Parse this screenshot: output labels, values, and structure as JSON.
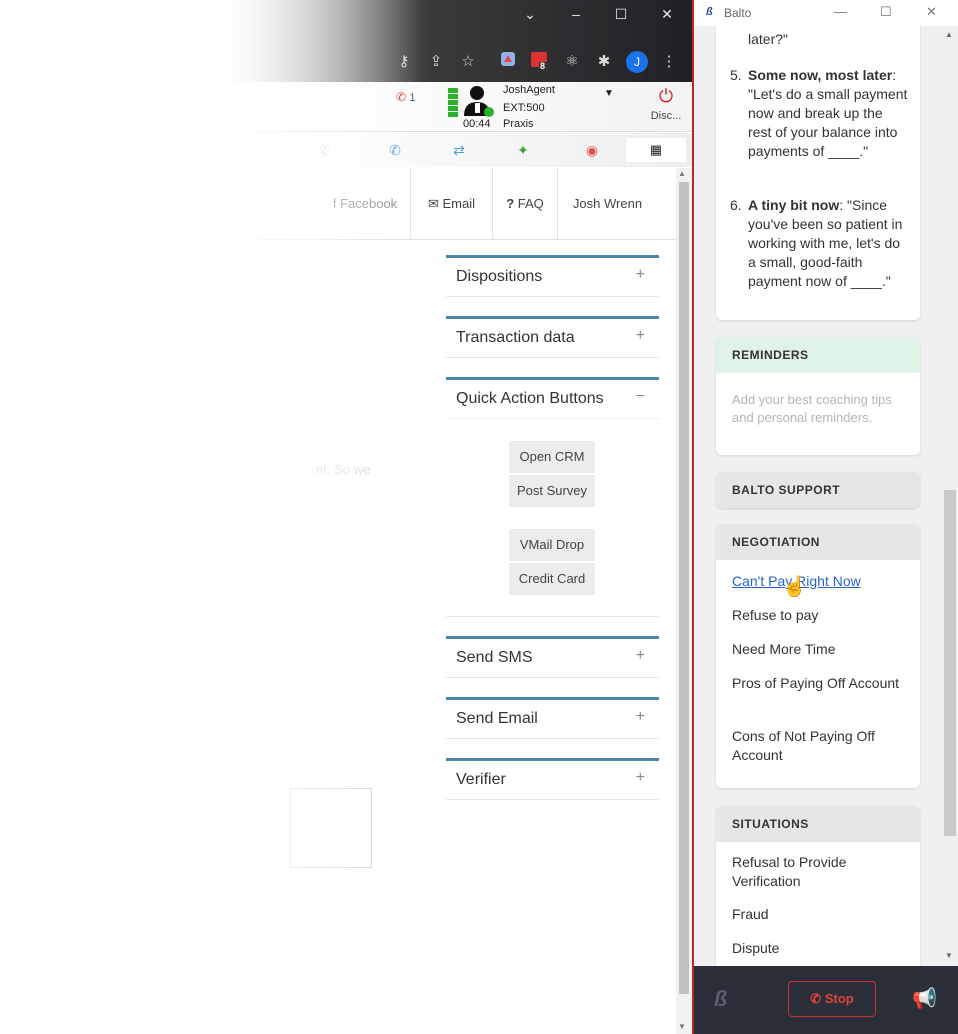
{
  "browser": {
    "window_controls": {
      "minimize": "–",
      "maximize": "☐",
      "close": "✕",
      "tab_menu": "⌄"
    },
    "profile_initial": "J",
    "extension_badge": "8"
  },
  "agent": {
    "missed_count": "1",
    "name": "JoshAgent",
    "ext": "EXT:500",
    "timer": "00:44",
    "campaign": "Praxis",
    "disconnect_label": "Disc..."
  },
  "nav": {
    "facebook": "Facebook",
    "email": "Email",
    "faq": "FAQ",
    "user": "Josh Wrenn"
  },
  "partial_text": "nt. So we",
  "panels": {
    "dispositions": "Dispositions",
    "transaction": "Transaction data",
    "quick_actions": "Quick Action Buttons",
    "send_sms": "Send SMS",
    "send_email": "Send Email",
    "verifier": "Verifier",
    "plus": "+",
    "minus": "−"
  },
  "quick_buttons": [
    "Open CRM",
    "Post Survey",
    "VMail Drop",
    "Credit Card"
  ],
  "balto": {
    "window_title": "Balto",
    "script": {
      "prev_tail": "later?\"",
      "item5_num": "5.",
      "item5_bold": "Some now, most later",
      "item5_text": ": \"Let's do a small payment now and break up the rest of your balance into payments of ____.\"",
      "item6_num": "6.",
      "item6_bold": "A tiny bit now",
      "item6_text": ": \"Since you've been so patient in working with me, let's do a small, good-faith payment now of ____.\""
    },
    "reminders": {
      "title": "REMINDERS",
      "placeholder": "Add your best coaching tips and personal reminders."
    },
    "support": {
      "title": "BALTO SUPPORT"
    },
    "negotiation": {
      "title": "NEGOTIATION",
      "items": [
        "Can't Pay Right Now",
        "Refuse to pay",
        "Need More Time",
        "Pros of Paying Off Account",
        "Cons of Not Paying Off Account"
      ]
    },
    "situations": {
      "title": "SITUATIONS",
      "items": [
        "Refusal to Provide Verification",
        "Fraud",
        "Dispute"
      ]
    },
    "footer": {
      "stop_label": "Stop"
    }
  },
  "colors": {
    "panel_accent": "#4a86a8",
    "reminders_header": "#dff3e6",
    "link": "#2a63c8",
    "stop": "#e0443e",
    "footer_bg": "#2b2f3a"
  }
}
